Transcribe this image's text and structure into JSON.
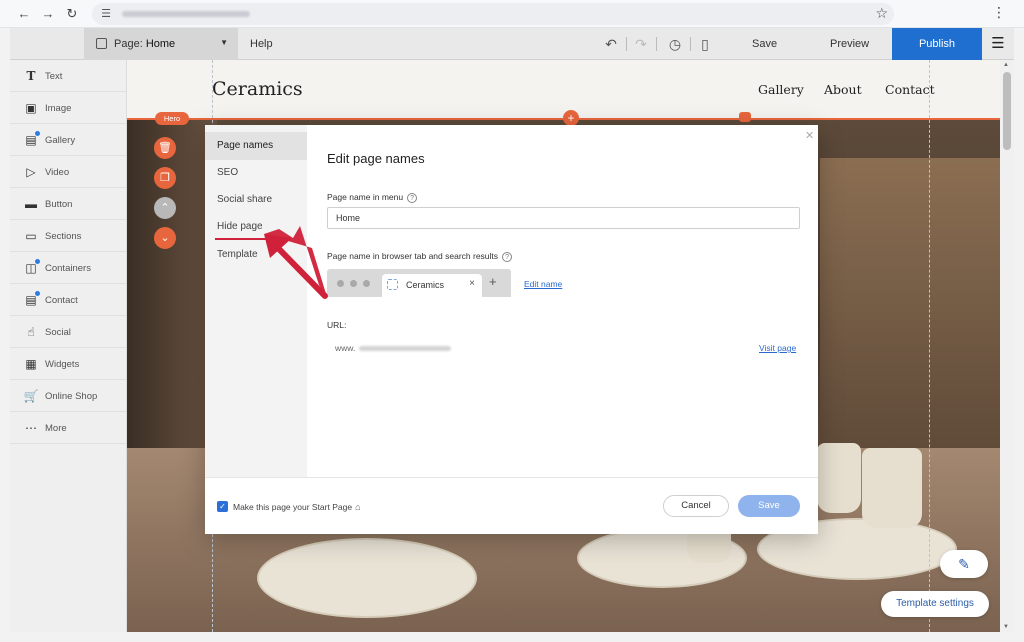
{
  "browser": {
    "menu_icon": "kebab-icon"
  },
  "topbar": {
    "page_label": "Page:",
    "page_value": "Home",
    "help": "Help",
    "save": "Save",
    "preview": "Preview",
    "publish": "Publish"
  },
  "sidebar": {
    "items": [
      {
        "label": "Text",
        "icon": "text-icon"
      },
      {
        "label": "Image",
        "icon": "image-icon"
      },
      {
        "label": "Gallery",
        "icon": "gallery-icon"
      },
      {
        "label": "Video",
        "icon": "video-icon"
      },
      {
        "label": "Button",
        "icon": "button-icon"
      },
      {
        "label": "Sections",
        "icon": "sections-icon"
      },
      {
        "label": "Containers",
        "icon": "containers-icon"
      },
      {
        "label": "Contact",
        "icon": "contact-icon"
      },
      {
        "label": "Social",
        "icon": "social-icon"
      },
      {
        "label": "Widgets",
        "icon": "widgets-icon"
      },
      {
        "label": "Online Shop",
        "icon": "cart-icon"
      },
      {
        "label": "More",
        "icon": "more-icon"
      }
    ]
  },
  "site": {
    "logo": "Ceramics",
    "nav": [
      "Gallery",
      "About",
      "Contact"
    ],
    "hero_tag": "Hero"
  },
  "modal": {
    "nav": [
      "Page names",
      "SEO",
      "Social share",
      "Hide page",
      "Template"
    ],
    "title": "Edit page names",
    "menu_name_label": "Page name in menu",
    "menu_name_value": "Home",
    "browser_name_label": "Page name in browser tab and search results",
    "tab_title": "Ceramics",
    "edit_name": "Edit name",
    "url_label": "URL:",
    "url_prefix": "www.",
    "visit_page": "Visit page",
    "start_page_label": "Make this page your Start Page",
    "cancel": "Cancel",
    "save": "Save"
  },
  "canvas": {
    "template_settings": "Template settings"
  },
  "colors": {
    "accent": "#1e6fd0",
    "hero": "#e8663d",
    "annotation": "#d0213a"
  }
}
